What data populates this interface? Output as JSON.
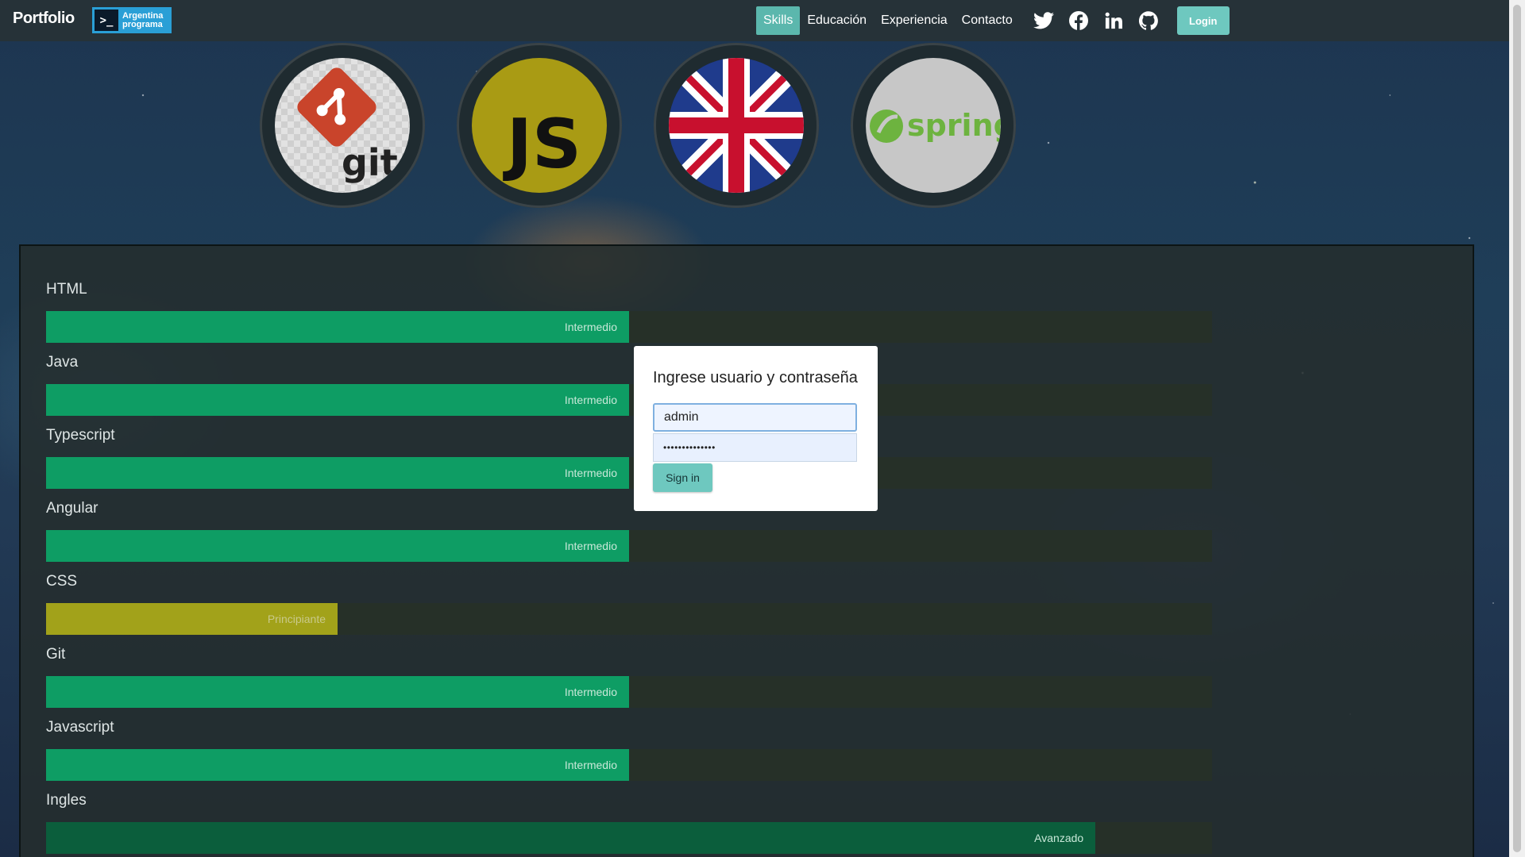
{
  "navbar": {
    "brand": "Portfolio",
    "logo_text_line1": "Argentina",
    "logo_text_line2": "programa",
    "links": [
      "Skills",
      "Educación",
      "Experiencia",
      "Contacto"
    ],
    "active_link": "Skills",
    "social_icons": [
      "twitter-icon",
      "facebook-icon",
      "linkedin-icon",
      "github-icon"
    ],
    "login_label": "Login"
  },
  "skill_logos": [
    {
      "name": "git",
      "label": "git"
    },
    {
      "name": "javascript",
      "label": "JS"
    },
    {
      "name": "english",
      "label": ""
    },
    {
      "name": "spring",
      "label": "spring"
    }
  ],
  "skills": [
    {
      "name": "HTML",
      "level": "Intermedio",
      "percent": 50,
      "color": "#0e9d64"
    },
    {
      "name": "Java",
      "level": "Intermedio",
      "percent": 50,
      "color": "#0e9d64"
    },
    {
      "name": "Typescript",
      "level": "Intermedio",
      "percent": 50,
      "color": "#0e9d64"
    },
    {
      "name": "Angular",
      "level": "Intermedio",
      "percent": 50,
      "color": "#0e9d64"
    },
    {
      "name": "CSS",
      "level": "Principiante",
      "percent": 25,
      "color": "#a2a21a"
    },
    {
      "name": "Git",
      "level": "Intermedio",
      "percent": 50,
      "color": "#0e9d64"
    },
    {
      "name": "Javascript",
      "level": "Intermedio",
      "percent": 50,
      "color": "#0e9d64"
    },
    {
      "name": "Ingles",
      "level": "Avanzado",
      "percent": 90,
      "color": "#0b5e3c"
    }
  ],
  "login_modal": {
    "title": "Ingrese usuario y contraseña",
    "username": "admin",
    "password_mask": "••••••••••••••",
    "submit_label": "Sign in"
  }
}
